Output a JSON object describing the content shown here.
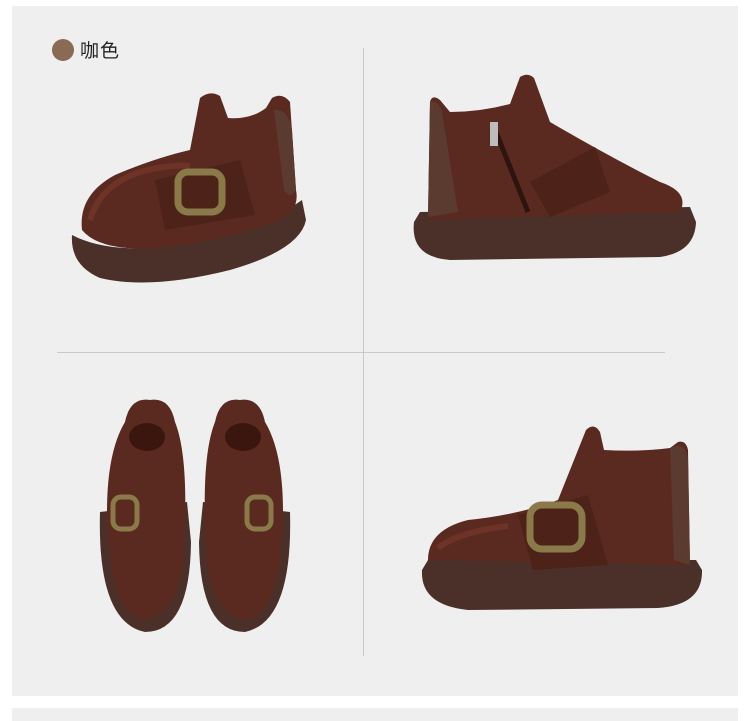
{
  "color_option": {
    "label": "咖色",
    "swatch_color": "#8a6a55"
  },
  "colors": {
    "leather": "#5a2a20",
    "leather_highlight": "#7a3b2c",
    "sole": "#4a3029",
    "buckle": "#8a7a4a",
    "suede": "#5b3a30"
  },
  "views": [
    {
      "name": "front-three-quarter"
    },
    {
      "name": "back-side-zip"
    },
    {
      "name": "front-pair"
    },
    {
      "name": "side-profile"
    }
  ]
}
